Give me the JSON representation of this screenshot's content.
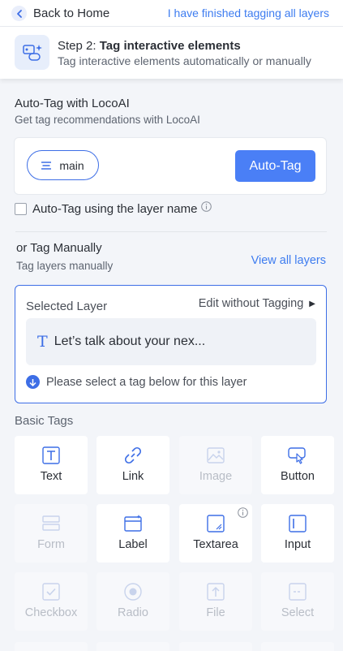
{
  "topbar": {
    "back_label": "Back to Home",
    "finished_label": "I have finished tagging all layers"
  },
  "step": {
    "prefix": "Step 2:",
    "title": "Tag interactive elements",
    "subtitle": "Tag interactive elements automatically or manually"
  },
  "autotag": {
    "title": "Auto-Tag with LocoAI",
    "subtitle": "Get tag recommendations with LocoAI",
    "branch_label": "main",
    "button_label": "Auto-Tag",
    "checkbox_label": "Auto-Tag using the layer name"
  },
  "manual": {
    "title": "or Tag Manually",
    "subtitle": "Tag layers manually",
    "view_all_label": "View all layers"
  },
  "selected_layer": {
    "title": "Selected Layer",
    "edit_without_label": "Edit without Tagging",
    "layer_name": "Let’s talk about your nex...",
    "hint": "Please select a tag below for this layer"
  },
  "basic_tags": {
    "title": "Basic Tags",
    "tags": [
      {
        "label": "Text",
        "icon": "text-tag-icon",
        "enabled": true
      },
      {
        "label": "Link",
        "icon": "link-icon",
        "enabled": true
      },
      {
        "label": "Image",
        "icon": "image-icon",
        "enabled": false
      },
      {
        "label": "Button",
        "icon": "button-pointer-icon",
        "enabled": true
      },
      {
        "label": "Form",
        "icon": "form-icon",
        "enabled": false
      },
      {
        "label": "Label",
        "icon": "label-icon",
        "enabled": true
      },
      {
        "label": "Textarea",
        "icon": "textarea-icon",
        "enabled": true
      },
      {
        "label": "Input",
        "icon": "input-icon",
        "enabled": true
      },
      {
        "label": "Checkbox",
        "icon": "checkbox-icon",
        "enabled": false
      },
      {
        "label": "Radio",
        "icon": "radio-icon",
        "enabled": false
      },
      {
        "label": "File",
        "icon": "file-upload-icon",
        "enabled": false
      },
      {
        "label": "Select",
        "icon": "select-icon",
        "enabled": false
      }
    ]
  },
  "colors": {
    "accent": "#3d7cf0",
    "button": "#4a7ff6",
    "icon_active": "#3d6ee6",
    "icon_disabled": "#c8d3ec"
  }
}
